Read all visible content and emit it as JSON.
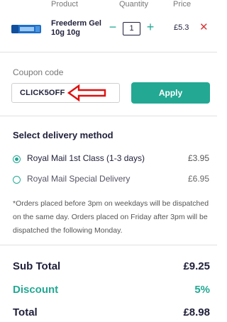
{
  "table_header": {
    "product": "Product",
    "quantity": "Quantity",
    "price": "Price"
  },
  "item": {
    "name": "Freederm Gel 10g 10g",
    "quantity": "1",
    "minus": "−",
    "plus": "+",
    "price": "£5.3",
    "remove": "✕"
  },
  "coupon": {
    "label": "Coupon code",
    "value": "CLICK5OFF",
    "apply_label": "Apply"
  },
  "delivery": {
    "title": "Select delivery method",
    "options": [
      {
        "label": "Royal Mail 1st Class (1-3 days)",
        "price": "£3.95",
        "selected": true
      },
      {
        "label": "Royal Mail Special Delivery",
        "price": "£6.95",
        "selected": false
      }
    ],
    "note": "*Orders placed before 3pm on weekdays will be dispatched on the same day. Orders placed on Friday after 3pm will be dispatched the following Monday."
  },
  "totals": {
    "subtotal_label": "Sub Total",
    "subtotal": "£9.25",
    "discount_label": "Discount",
    "discount": "5%",
    "total_label": "Total",
    "total": "£8.98"
  },
  "colors": {
    "accent": "#23a893",
    "text": "#1f1f3a",
    "remove": "#d63a3a",
    "annotation": "#e01010"
  }
}
